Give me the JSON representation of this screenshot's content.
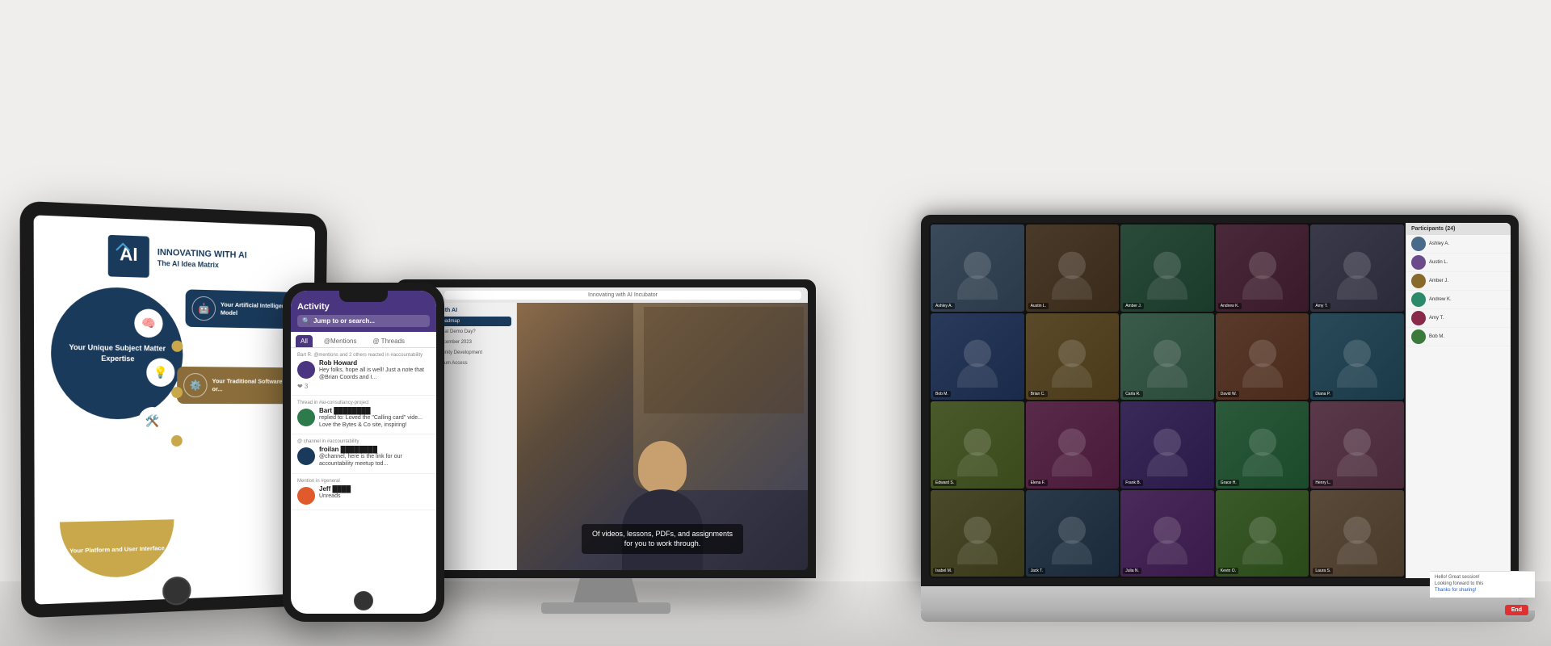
{
  "brand": {
    "name": "INNOVATING\nWITH AI",
    "tagline": "The AI Idea Matrix"
  },
  "tablet": {
    "diagram": {
      "left_circle_text": "Your Unique Subject Matter Expertise",
      "bottom_text": "Your Platform and User Interface",
      "ai_model_label": "Your Artificial Intelligence Model",
      "software_label": "Your Traditional Software or..."
    }
  },
  "phone": {
    "header": "Activity",
    "search_placeholder": "Jump to or search...",
    "tabs": [
      "All",
      "@Mentions",
      "@ Threads"
    ],
    "activity_items": [
      {
        "meta": "Bart R. @mentions and 2 others reacted in #accountability",
        "user": "Rob Howard",
        "text": "Hey folks, hope all is well! Just a note that @Brian Coords and I...",
        "reactions": "❤ 3"
      },
      {
        "meta": "Thread in #ai-consultancy-project",
        "user": "Bart ████████",
        "text": "replied to: Loved the \"Calling card\" vide... Love the Bytes & Co site, inspiring!"
      },
      {
        "meta": "@ channel in #accountability",
        "user": "froilan ████████",
        "text": "@channel, here is the link for our accountability meetup tod..."
      },
      {
        "meta": "Mention in #general",
        "user": "Jeff ████",
        "text": "Unreads"
      }
    ]
  },
  "monitor": {
    "url": "Innovating with AI Incubator",
    "sidebar_title": "Innovating with AI",
    "sidebar_items": [
      "1 - Realistic Roadmap",
      "What happens at Demo Day?",
      "Demo Day, December 2023",
      "#Slack Community Development",
      "Offline Curriculum Access"
    ],
    "video_caption": "Of videos, lessons, PDFs, and assignments for you to work through."
  },
  "laptop": {
    "zoom_participants": [
      "Ashley A.",
      "Austin L.",
      "Amber J.",
      "Andrew K.",
      "Amy T.",
      "Bob M.",
      "Brian C.",
      "Carla R.",
      "David W.",
      "Diana P.",
      "Edward S.",
      "Elena F.",
      "Frank B.",
      "Grace H.",
      "Henry L.",
      "Isabel M.",
      "Jack T.",
      "Julia N.",
      "Kevin O.",
      "Laura S."
    ],
    "sidebar_title": "Participants (24)",
    "chat_items": [
      "Hello! Great session today!",
      "Looking forward to this",
      "Thanks for sharing!"
    ]
  },
  "colors": {
    "navy": "#1a3a5c",
    "purple": "#4a3580",
    "gold": "#c8a84b",
    "brown": "#8a6d3a"
  }
}
